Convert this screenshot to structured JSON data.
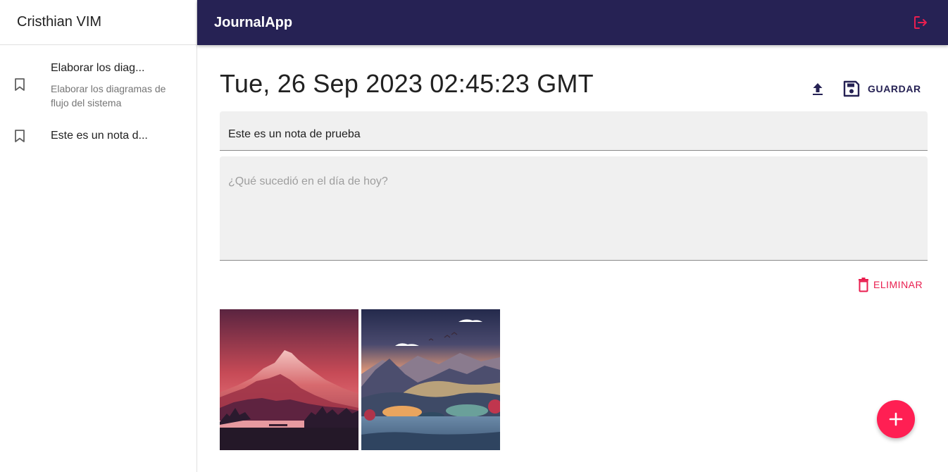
{
  "sidebar": {
    "user_name": "Cristhian VIM",
    "notes": [
      {
        "title": "Elaborar los diag...",
        "body": "Elaborar los diagramas de flujo del sistema"
      },
      {
        "title": "Este es un nota d...",
        "body": ""
      }
    ]
  },
  "topbar": {
    "app_title": "JournalApp",
    "logout_icon": "logout-icon"
  },
  "main": {
    "date": "Tue, 26 Sep 2023 02:45:23 GMT",
    "upload_icon": "upload-icon",
    "save_label": "GUARDAR",
    "title_value": "Este es un nota de prueba",
    "body_placeholder": "¿Qué sucedió en el día de hoy?",
    "body_value": "",
    "delete_label": "ELIMINAR",
    "images": [
      "red-mountain-landscape",
      "sunset-lake-forest-landscape"
    ]
  },
  "colors": {
    "primary": "#262254",
    "secondary": "#ff1f53",
    "error": "#e91e4f",
    "field_bg": "#f0f0f0"
  }
}
